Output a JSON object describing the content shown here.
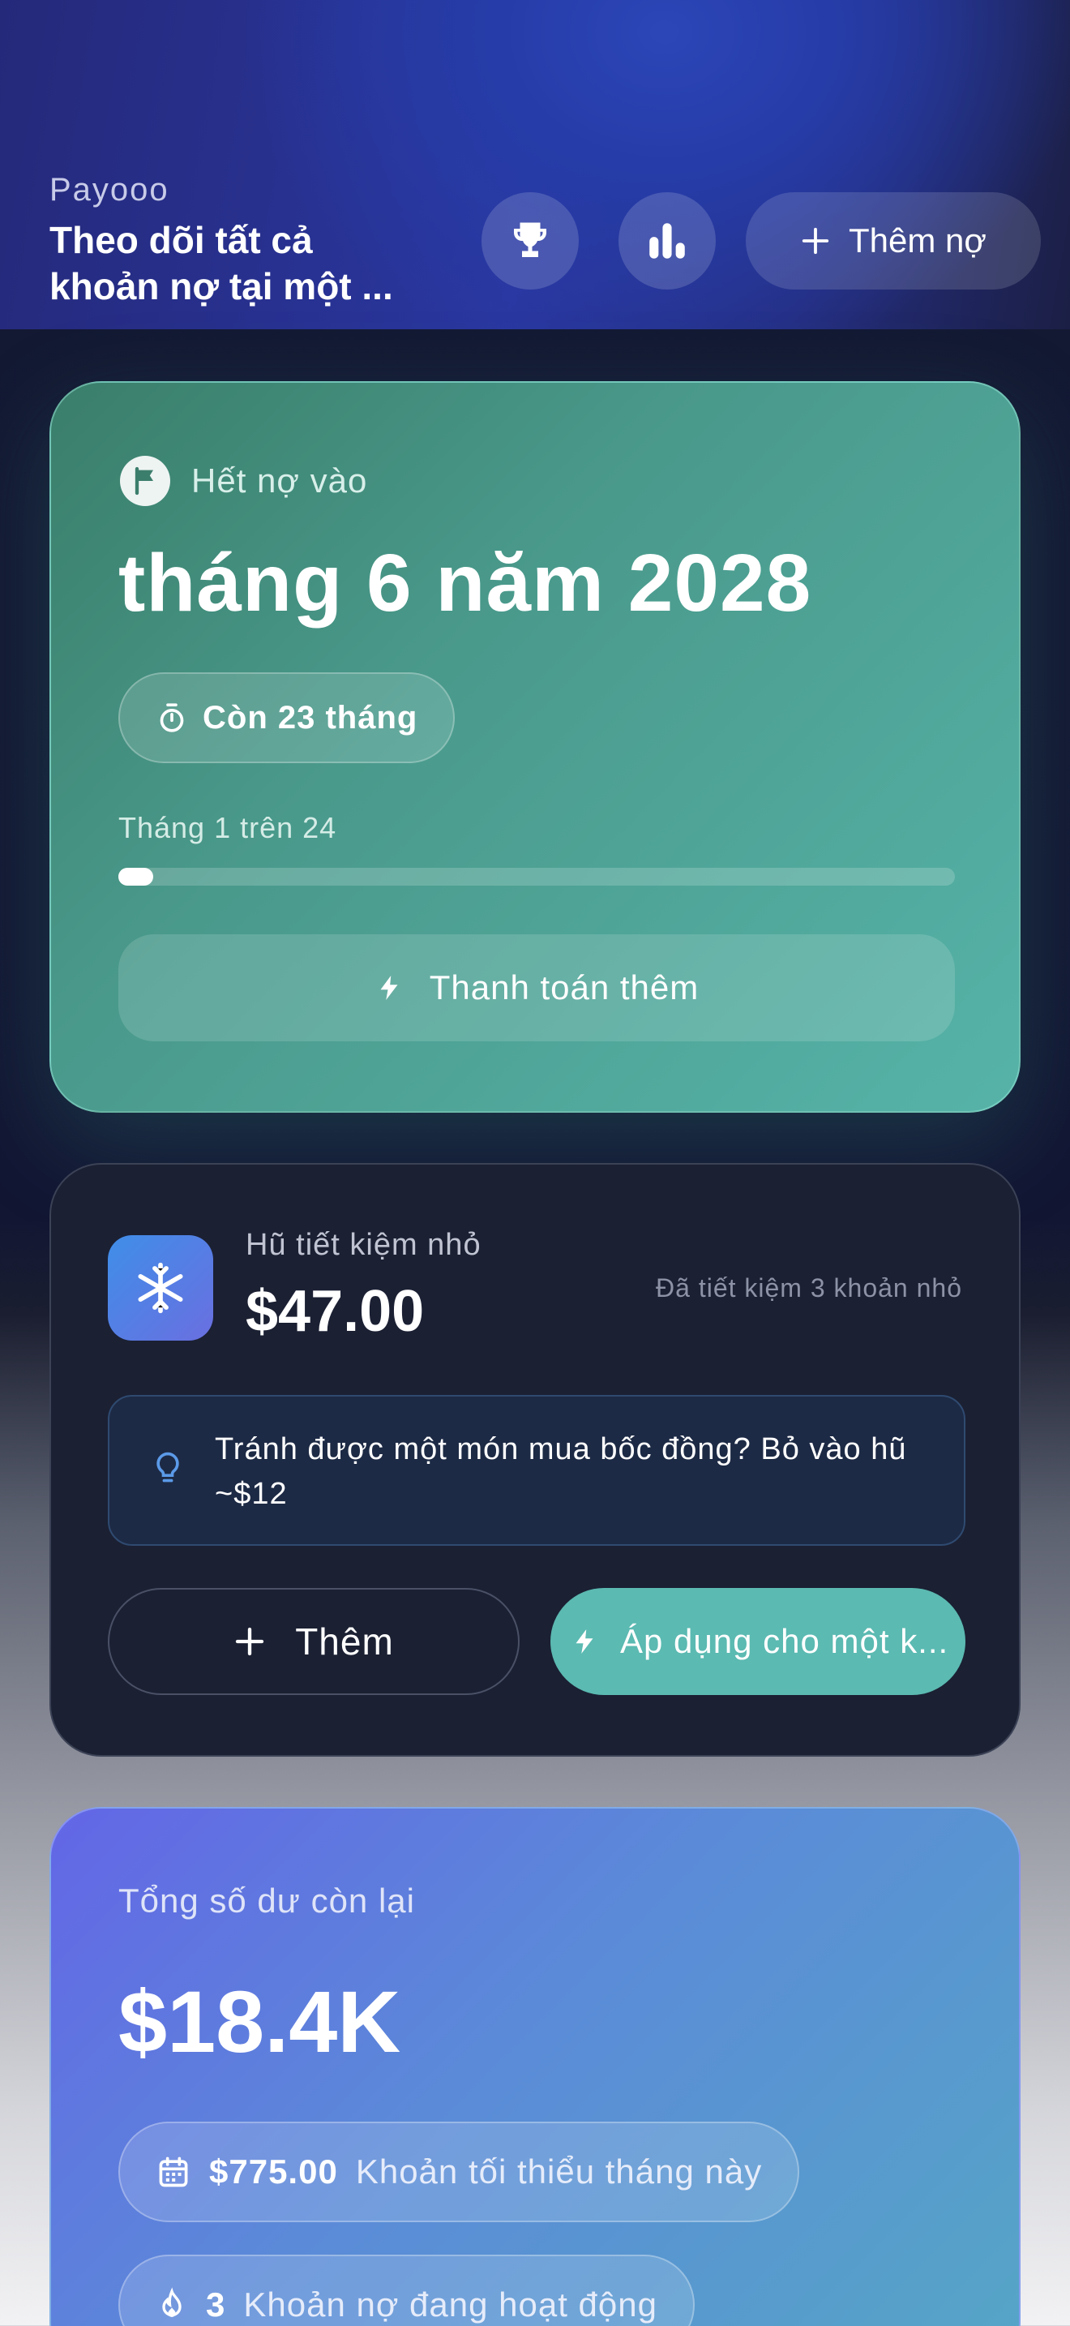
{
  "header": {
    "brand": "Payooo",
    "subtitle": "Theo dõi tất cả khoản nợ tại một ...",
    "trophy_icon": "trophy-icon",
    "chart_icon": "bar-chart-icon",
    "add_debt_label": "Thêm nợ"
  },
  "debt_free": {
    "label": "Hết nợ vào",
    "date": "tháng 6 năm 2028",
    "remaining": "Còn 23 tháng",
    "progress_label": "Tháng 1 trên 24",
    "progress_fraction": 0.0417,
    "pay_extra_label": "Thanh toán thêm"
  },
  "savings_jar": {
    "title": "Hũ tiết kiệm nhỏ",
    "amount": "$47.00",
    "saved_note": "Đã tiết kiệm 3 khoản nhỏ",
    "tip": "Tránh được một món mua bốc đồng? Bỏ vào hũ ~$12",
    "add_label": "Thêm",
    "apply_label": "Áp dụng cho một k..."
  },
  "balance": {
    "label": "Tổng số dư còn lại",
    "amount": "$18.4K",
    "min_payment_value": "$775.00",
    "min_payment_desc": "Khoản tối thiểu tháng này",
    "active_count": "3",
    "active_desc": "Khoản nợ đang hoạt động"
  },
  "colors": {
    "header_blue": "#2a37a0",
    "card_green": "#4a9a8c",
    "card_dark": "#1b2033",
    "accent_teal": "#5bbab2",
    "card_blue": "#5b8bd8"
  }
}
